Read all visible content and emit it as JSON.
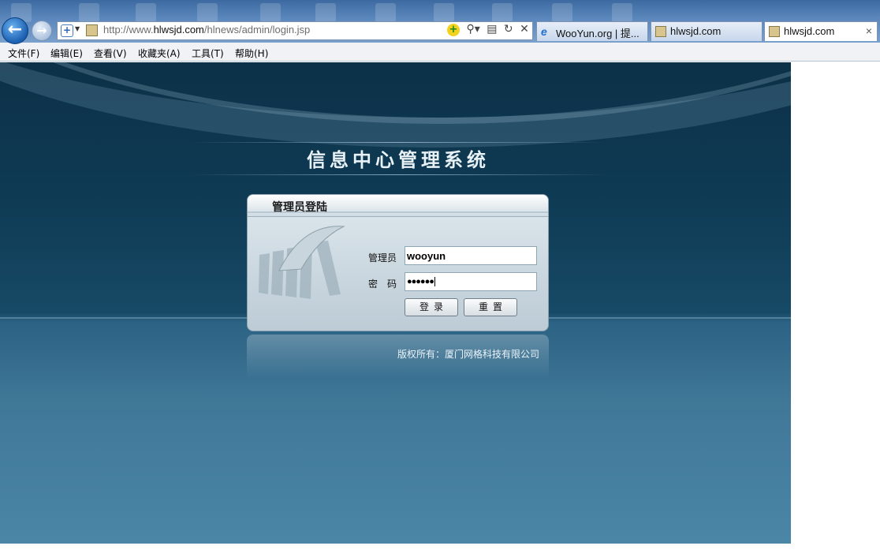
{
  "browser": {
    "address": {
      "scheme": "http://www.",
      "domain": "hlwsjd.com",
      "path": "/hlnews/admin/login.jsp"
    },
    "tabs": [
      {
        "label": "WooYun.org | 提...",
        "icon": "ie-icon",
        "active": false
      },
      {
        "label": "hlwsjd.com",
        "icon": "image-icon",
        "active": false
      },
      {
        "label": "hlwsjd.com",
        "icon": "image-icon",
        "active": true
      }
    ],
    "close_glyph": "×",
    "menu": [
      "文件(F)",
      "编辑(E)",
      "查看(V)",
      "收藏夹(A)",
      "工具(T)",
      "帮助(H)"
    ]
  },
  "page": {
    "title": "信息中心管理系统",
    "login": {
      "header": "管理员登陆",
      "username_label": "管理员",
      "username_value": "wooyun",
      "password_label": "密　码",
      "password_value": "●●●●●●",
      "login_button": "登录",
      "reset_button": "重置"
    },
    "copyright": "版权所有：厦门网格科技有限公司"
  },
  "colors": {
    "page_top": "#0c3148",
    "page_bottom": "#4b86a6",
    "chrome": "#5c88bd"
  }
}
